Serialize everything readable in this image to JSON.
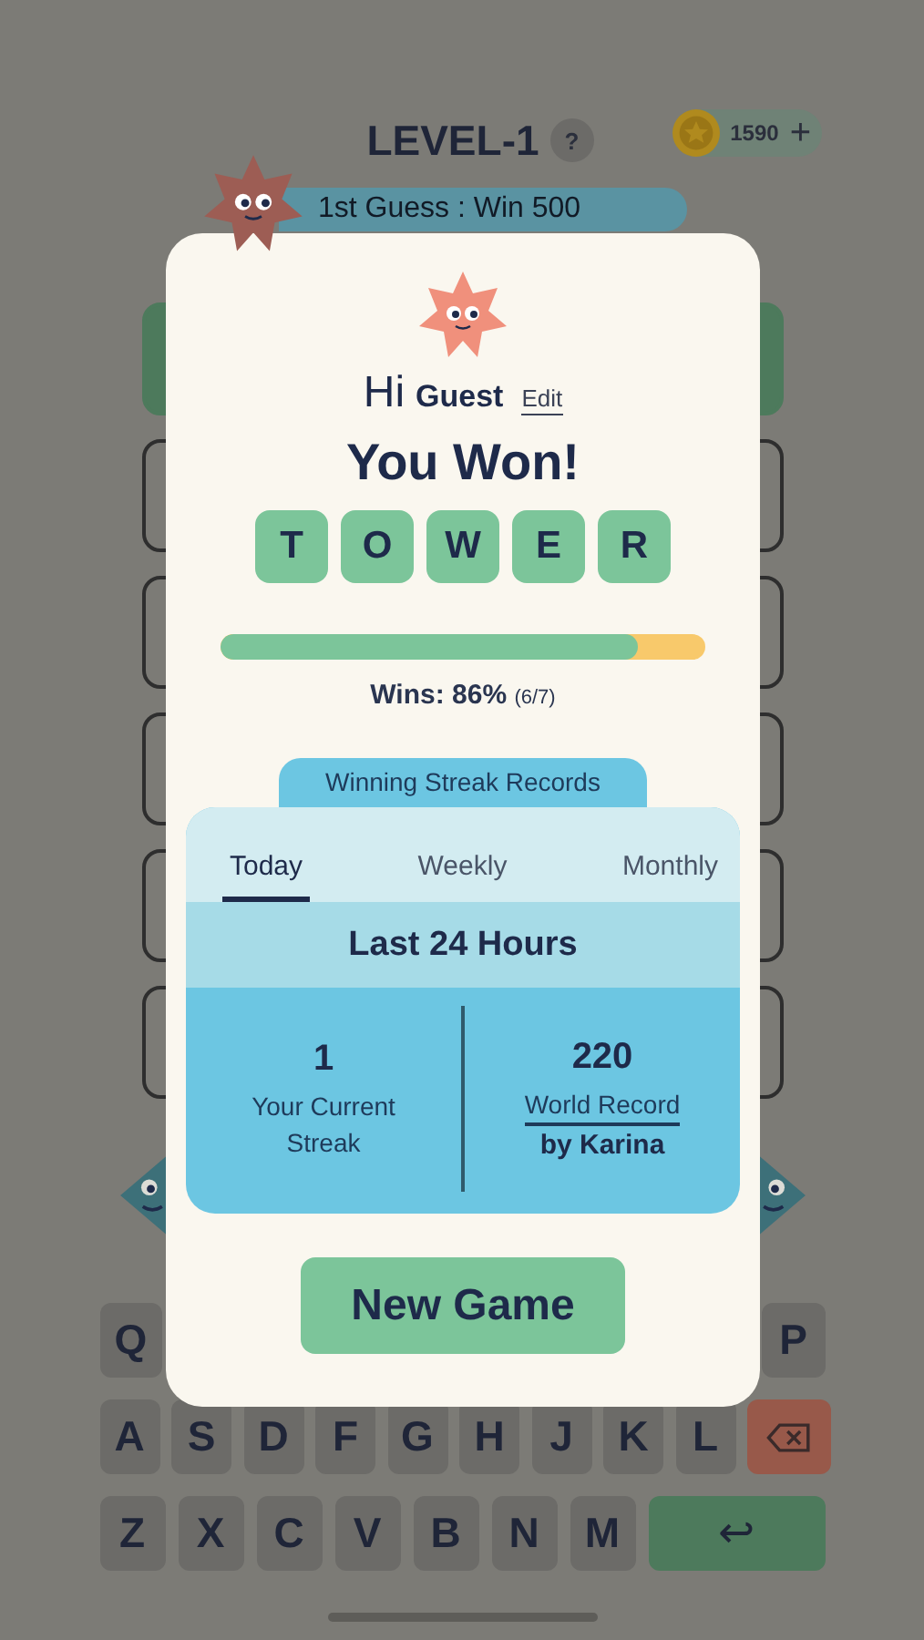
{
  "header": {
    "title": "LEVEL-1",
    "help": "?",
    "coins": "1590",
    "add": "+"
  },
  "banner": {
    "text": "1st Guess : Win 500"
  },
  "modal": {
    "greeting": "Hi",
    "name": "Guest",
    "edit": "Edit",
    "title": "You Won!",
    "word": [
      "T",
      "O",
      "W",
      "E",
      "R"
    ],
    "wins": {
      "level": 0.86,
      "label": "Wins: 86%",
      "count": "(6/7)"
    },
    "records": {
      "title": "Winning Streak Records",
      "tabs": [
        {
          "label": "Today",
          "selected": true
        },
        {
          "label": "Weekly",
          "selected": false
        },
        {
          "label": "Monthly",
          "selected": false
        }
      ],
      "period": "Last 24 Hours",
      "stats": [
        {
          "kind": "plain",
          "value": "1",
          "label": "Your Current Streak"
        },
        {
          "kind": "record",
          "value": "220",
          "label": "World Record",
          "by": "by Karina"
        }
      ]
    },
    "button": "New Game"
  },
  "keyboard": {
    "rows": [
      [
        {
          "kind": "letter",
          "label": "Q"
        },
        {
          "kind": "letter",
          "label": "P"
        }
      ],
      [
        {
          "kind": "letter",
          "label": "A"
        },
        {
          "kind": "letter",
          "label": "S"
        },
        {
          "kind": "letter",
          "label": "D"
        },
        {
          "kind": "letter",
          "label": "F"
        },
        {
          "kind": "letter",
          "label": "G"
        },
        {
          "kind": "letter",
          "label": "H"
        },
        {
          "kind": "letter",
          "label": "J"
        },
        {
          "kind": "letter",
          "label": "K"
        },
        {
          "kind": "letter",
          "label": "L"
        },
        {
          "kind": "backspace"
        }
      ],
      [
        {
          "kind": "letter",
          "label": "Z"
        },
        {
          "kind": "letter",
          "label": "X"
        },
        {
          "kind": "letter",
          "label": "C"
        },
        {
          "kind": "letter",
          "label": "V"
        },
        {
          "kind": "letter",
          "label": "B"
        },
        {
          "kind": "letter",
          "label": "N"
        },
        {
          "kind": "letter",
          "label": "M"
        },
        {
          "kind": "enter",
          "label": "↩"
        }
      ]
    ]
  }
}
